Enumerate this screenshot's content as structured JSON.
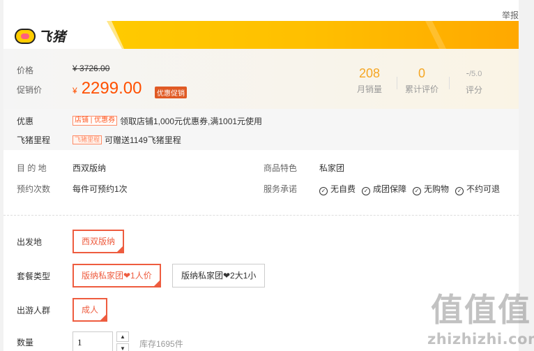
{
  "header": {
    "report_label": "举报"
  },
  "brand": {
    "logo_text": "飞猪"
  },
  "price": {
    "price_label": "价格",
    "old_price": "3726.00",
    "currency": "¥",
    "promo_label": "促销价",
    "promo_price": "2299.00",
    "promo_tag": "优惠促销"
  },
  "stats": {
    "monthly_sales_value": "208",
    "monthly_sales_label": "月销量",
    "reviews_value": "0",
    "reviews_label": "累计评价",
    "rating_value": "-",
    "rating_scale": "/5.0",
    "rating_label": "评分"
  },
  "offers": {
    "discount_label": "优惠",
    "coupon_tag": "店铺 | 优惠券",
    "coupon_text": "领取店铺1,000元优惠券,满1001元使用",
    "miles_label": "飞猪里程",
    "miles_tag": "飞猪里程",
    "miles_text": "可赠送1149飞猪里程"
  },
  "details": {
    "destination_label": "目 的 地",
    "destination_value": "西双版纳",
    "feature_label": "商品特色",
    "feature_value": "私家团",
    "booking_label": "预约次数",
    "booking_value": "每件可预约1次",
    "service_label": "服务承诺",
    "services": [
      "无自费",
      "成团保障",
      "无购物",
      "不约可退"
    ]
  },
  "options": {
    "departure_label": "出发地",
    "departure_selected": "西双版纳",
    "package_label": "套餐类型",
    "packages": [
      "版纳私家团❤1人价",
      "版纳私家团❤2大1小"
    ],
    "group_label": "出游人群",
    "group_selected": "成人",
    "quantity_label": "数量",
    "quantity_value": "1",
    "stock_text": "库存1695件"
  },
  "watermark": {
    "chars": "值值值",
    "url": "zhizhizhi.com"
  },
  "colors": {
    "accent": "#ff5000",
    "selected_border": "#ee5c3f",
    "banner": "#ffbf00",
    "stat": "#f5a623"
  }
}
